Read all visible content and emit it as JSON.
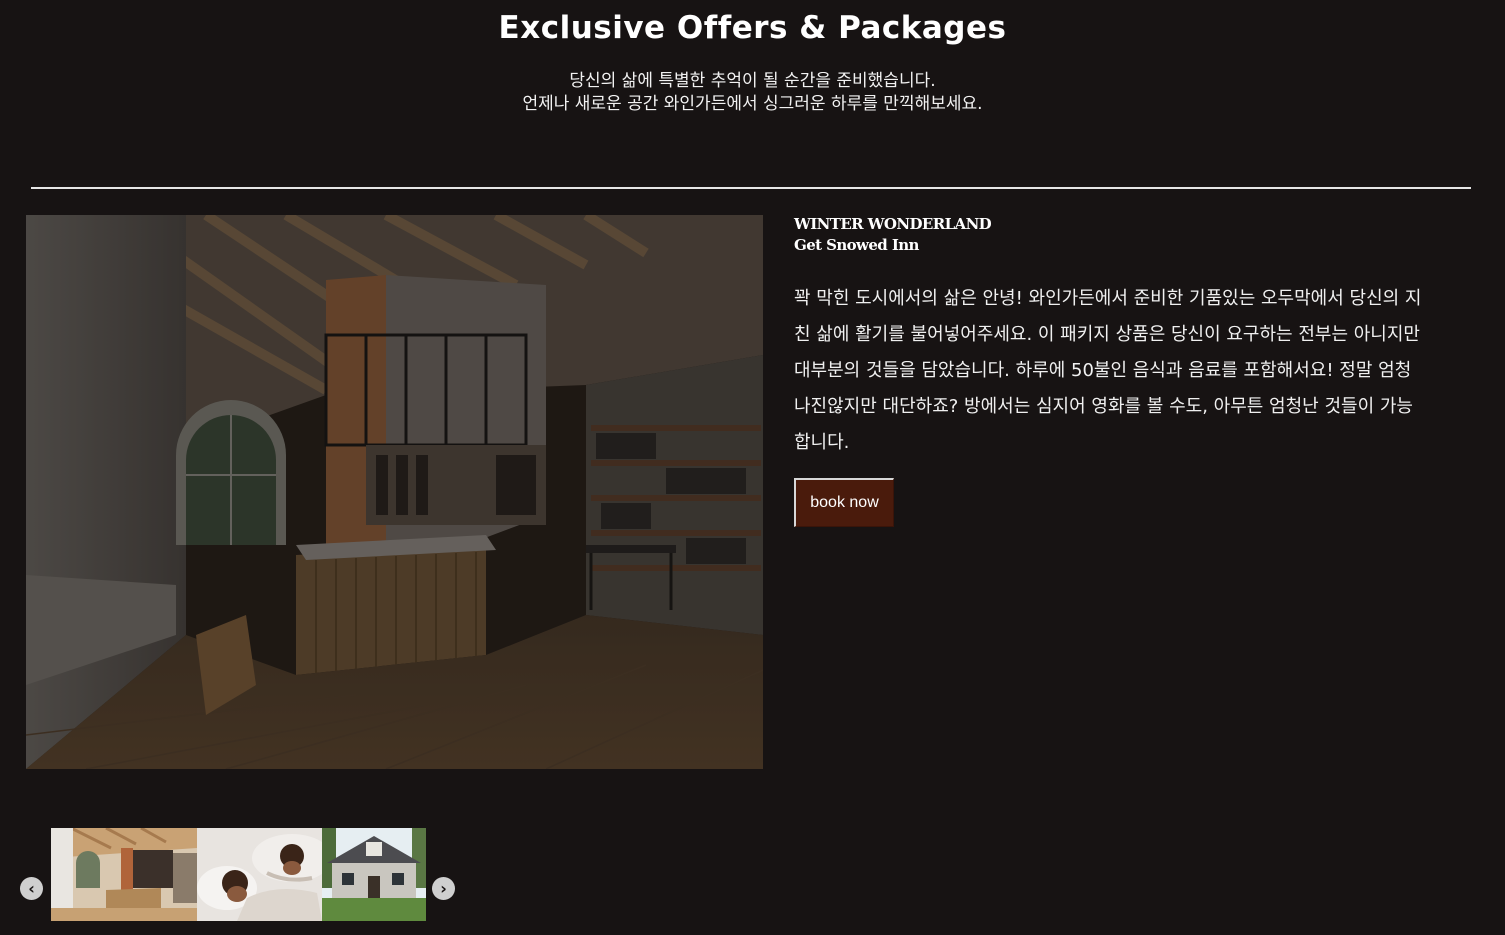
{
  "header": {
    "title": "Exclusive Offers & Packages",
    "subtitle_line1": "당신의 삶에 특별한 추억이 될 순간을 준비했습니다.",
    "subtitle_line2": "언제나 새로운 공간 와인가든에서 싱그러운 하루를 만끽해보세요."
  },
  "offer": {
    "kicker": "WINTER WONDERLAND",
    "name": "Get Snowed Inn",
    "description": "꽉 막힌 도시에서의 삶은 안녕! 와인가든에서 준비한 기품있는 오두막에서 당신의 지친 삶에 활기를 불어넣어주세요. 이 패키지 상품은 당신이 요구하는 전부는 아니지만 대부분의 것들을 담았습니다. 하루에 50불인 음식과 음료를 포함해서요! 정말 엄청나진않지만 대단하죠? 방에서는 심지어 영화를 볼 수도, 아무튼 엄청난 것들이 가능합니다.",
    "book_label": "book now"
  },
  "carousel": {
    "prev_icon": "chevron-left-icon",
    "next_icon": "chevron-right-icon",
    "prev_glyph": "‹",
    "next_glyph": "›"
  },
  "colors": {
    "background": "#171313",
    "button": "#4a1b0c",
    "divider": "#e6e6e6"
  }
}
